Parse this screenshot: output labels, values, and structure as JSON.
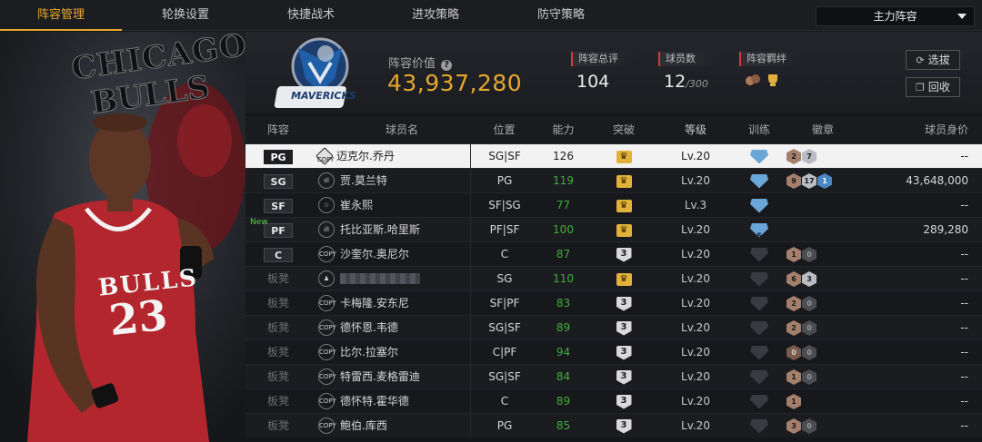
{
  "tabs": [
    {
      "label": "阵容管理",
      "active": true
    },
    {
      "label": "轮换设置",
      "active": false
    },
    {
      "label": "快捷战术",
      "active": false
    },
    {
      "label": "进攻策略",
      "active": false
    },
    {
      "label": "防守策略",
      "active": false
    }
  ],
  "lineup_select": {
    "value": "主力阵容"
  },
  "hero": {
    "team_word_1": "CHICAGO",
    "team_word_2": "BULLS",
    "jersey_team": "BULLS",
    "jersey_number": "23"
  },
  "summary": {
    "logo_text": "MAVERICKS",
    "value_label": "阵容价值",
    "value": "43,937,280",
    "rating_label": "阵容总评",
    "rating": "104",
    "count_label": "球员数",
    "count": "12",
    "count_max": "/300",
    "bond_label": "阵容羁绊",
    "accent_color": "#e6a72e"
  },
  "buttons": {
    "select": "选拔",
    "recycle": "回收"
  },
  "table": {
    "headers": {
      "pos": "阵容",
      "name": "球员名",
      "position": "位置",
      "ability": "能力",
      "breakthrough": "突破",
      "level": "等级",
      "training": "训练",
      "badges": "徽章",
      "value": "球员身价"
    },
    "rows": [
      {
        "slot": "PG",
        "bench": false,
        "new": false,
        "mark": "COPY",
        "mark_type": "dia",
        "name": "迈克尔.乔丹",
        "position": "SG|SF",
        "ability": "126",
        "green": false,
        "breakthrough": "crown",
        "level": "Lv.20",
        "training": "b",
        "training_num": "",
        "badges": [
          [
            "bronze",
            "2"
          ],
          [
            "silver",
            "7"
          ]
        ],
        "value": "--",
        "selected": true
      },
      {
        "slot": "SG",
        "bench": false,
        "new": false,
        "mark": "ıll",
        "mark_type": "circle",
        "name": "贾.莫兰特",
        "position": "PG",
        "ability": "119",
        "green": true,
        "breakthrough": "crown",
        "level": "Lv.20",
        "training": "b",
        "training_num": "",
        "badges": [
          [
            "bronze",
            "9"
          ],
          [
            "silver",
            "17"
          ],
          [
            "blue",
            "1"
          ]
        ],
        "value": "43,648,000",
        "selected": false
      },
      {
        "slot": "SF",
        "bench": false,
        "new": false,
        "mark": "☆",
        "mark_type": "circle",
        "name": "崔永熙",
        "position": "SF|SG",
        "ability": "77",
        "green": true,
        "breakthrough": "crown",
        "level": "Lv.3",
        "training": "b",
        "training_num": "",
        "badges": [],
        "value": "--",
        "selected": false
      },
      {
        "slot": "PF",
        "bench": false,
        "new": true,
        "new_label": "New",
        "mark": "ıll",
        "mark_type": "circle",
        "name": "托比亚斯.哈里斯",
        "position": "PF|SF",
        "ability": "100",
        "green": true,
        "breakthrough": "crown",
        "level": "Lv.20",
        "training": "b",
        "training_num": "5",
        "badges": [],
        "value": "289,280",
        "selected": false
      },
      {
        "slot": "C",
        "bench": false,
        "new": false,
        "mark": "COPY",
        "mark_type": "circle",
        "name": "沙奎尔.奥尼尔",
        "position": "C",
        "ability": "87",
        "green": true,
        "breakthrough": "3",
        "level": "Lv.20",
        "training": "g",
        "training_num": "",
        "badges": [
          [
            "bronze",
            "1"
          ],
          [
            "dark",
            "0"
          ]
        ],
        "value": "--",
        "selected": false
      },
      {
        "slot": "板凳",
        "bench": true,
        "new": false,
        "mark": "♟",
        "mark_type": "circle",
        "name": "",
        "blurred": true,
        "position": "SG",
        "ability": "110",
        "green": true,
        "breakthrough": "crown",
        "level": "Lv.20",
        "training": "g",
        "training_num": "",
        "badges": [
          [
            "bronze",
            "6"
          ],
          [
            "silver",
            "3"
          ]
        ],
        "value": "--",
        "selected": false
      },
      {
        "slot": "板凳",
        "bench": true,
        "new": false,
        "mark": "COPY",
        "mark_type": "circle",
        "name": "卡梅隆.安东尼",
        "position": "SF|PF",
        "ability": "83",
        "green": true,
        "breakthrough": "3",
        "level": "Lv.20",
        "training": "g",
        "training_num": "",
        "badges": [
          [
            "bronze",
            "2"
          ],
          [
            "dark",
            "0"
          ]
        ],
        "value": "--",
        "selected": false
      },
      {
        "slot": "板凳",
        "bench": true,
        "new": false,
        "mark": "COPY",
        "mark_type": "circle",
        "name": "德怀恩.韦德",
        "position": "SG|SF",
        "ability": "89",
        "green": true,
        "breakthrough": "3",
        "level": "Lv.20",
        "training": "g",
        "training_num": "",
        "badges": [
          [
            "bronze",
            "2"
          ],
          [
            "dark",
            "0"
          ]
        ],
        "value": "--",
        "selected": false
      },
      {
        "slot": "板凳",
        "bench": true,
        "new": false,
        "mark": "COPY",
        "mark_type": "circle",
        "name": "比尔.拉塞尔",
        "position": "C|PF",
        "ability": "94",
        "green": true,
        "breakthrough": "3",
        "level": "Lv.20",
        "training": "g",
        "training_num": "",
        "badges": [
          [
            "brz2",
            "0"
          ],
          [
            "dark",
            "0"
          ]
        ],
        "value": "--",
        "selected": false
      },
      {
        "slot": "板凳",
        "bench": true,
        "new": false,
        "mark": "COPY",
        "mark_type": "circle",
        "name": "特雷西.麦格雷迪",
        "position": "SG|SF",
        "ability": "84",
        "green": true,
        "breakthrough": "3",
        "level": "Lv.20",
        "training": "g",
        "training_num": "",
        "badges": [
          [
            "bronze",
            "1"
          ],
          [
            "dark",
            "0"
          ]
        ],
        "value": "--",
        "selected": false
      },
      {
        "slot": "板凳",
        "bench": true,
        "new": false,
        "mark": "COPY",
        "mark_type": "circle",
        "name": "德怀特.霍华德",
        "position": "C",
        "ability": "89",
        "green": true,
        "breakthrough": "3",
        "level": "Lv.20",
        "training": "g",
        "training_num": "",
        "badges": [
          [
            "bronze",
            "1"
          ]
        ],
        "value": "--",
        "selected": false
      },
      {
        "slot": "板凳",
        "bench": true,
        "new": false,
        "mark": "COPY",
        "mark_type": "circle",
        "name": "鲍伯.库西",
        "position": "PG",
        "ability": "85",
        "green": true,
        "breakthrough": "3",
        "level": "Lv.20",
        "training": "g",
        "training_num": "",
        "badges": [
          [
            "bronze",
            "3"
          ],
          [
            "dark",
            "0"
          ]
        ],
        "value": "--",
        "selected": false
      }
    ]
  }
}
